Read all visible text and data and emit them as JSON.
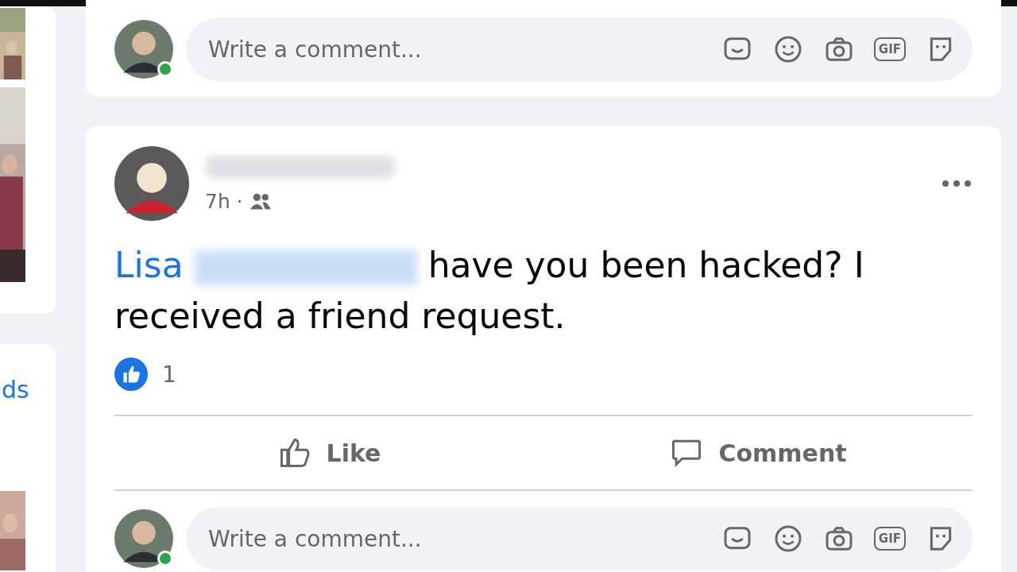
{
  "left_column": {
    "link_text": "ds"
  },
  "top_comment_box": {
    "placeholder": "Write a comment...",
    "gif_label": "GIF",
    "online": true
  },
  "post": {
    "time": "7h",
    "separator": "·",
    "mention": "Lisa",
    "text": "have you been hacked? I received a friend request.",
    "reaction_count": "1",
    "actions": [
      {
        "kind": "like",
        "label": "Like"
      },
      {
        "kind": "comment",
        "label": "Comment"
      }
    ],
    "comment_box": {
      "placeholder": "Write a comment...",
      "gif_label": "GIF",
      "online": true
    }
  }
}
